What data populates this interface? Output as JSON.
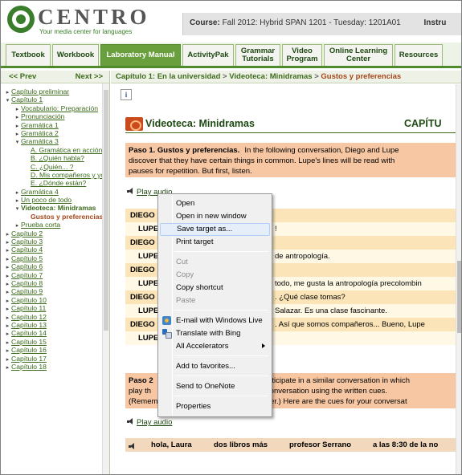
{
  "header": {
    "logo_text": "CENTRO",
    "logo_tagline": "Your media center for languages",
    "course_label": "Course:",
    "course_value": "Fall 2012: Hybrid SPAN 1201 - Tuesday: 1201A01",
    "course_tail": "Instru"
  },
  "tabs": [
    {
      "label": "Textbook",
      "active": false
    },
    {
      "label": "Workbook",
      "active": false
    },
    {
      "label": "Laboratory Manual",
      "active": true
    },
    {
      "label": "ActivityPak",
      "active": false
    },
    {
      "label": "Grammar Tutorials",
      "active": false
    },
    {
      "label": "Video Program",
      "active": false
    },
    {
      "label": "Online Learning Center",
      "active": false
    },
    {
      "label": "Resources",
      "active": false
    }
  ],
  "sidebar": {
    "prev": "<< Prev",
    "next": "Next >>",
    "items": [
      {
        "label": "Capítulo preliminar",
        "indent": 0,
        "toggle": "right"
      },
      {
        "label": "Capítulo 1",
        "indent": 0,
        "toggle": "down"
      },
      {
        "label": "Vocabulario: Preparación",
        "indent": 1,
        "toggle": "right"
      },
      {
        "label": "Pronunciación",
        "indent": 1,
        "toggle": "right"
      },
      {
        "label": "Gramática 1",
        "indent": 1,
        "toggle": "right"
      },
      {
        "label": "Gramática 2",
        "indent": 1,
        "toggle": "right"
      },
      {
        "label": "Gramática 3",
        "indent": 1,
        "toggle": "down"
      },
      {
        "label": "A. Gramática en acción:",
        "indent": 2,
        "toggle": ""
      },
      {
        "label": "B. ¿Quién habla?",
        "indent": 2,
        "toggle": ""
      },
      {
        "label": "C. ¿Quién... ?",
        "indent": 2,
        "toggle": ""
      },
      {
        "label": "D. Mis compañeros y yo",
        "indent": 2,
        "toggle": ""
      },
      {
        "label": "E. ¿Dónde están?",
        "indent": 2,
        "toggle": ""
      },
      {
        "label": "Gramática 4",
        "indent": 1,
        "toggle": "right"
      },
      {
        "label": "Un poco de todo",
        "indent": 1,
        "toggle": "right"
      },
      {
        "label": "Videoteca: Minidramas",
        "indent": 1,
        "toggle": "down",
        "state": "sel"
      },
      {
        "label": "Gustos y preferencias",
        "indent": 2,
        "toggle": "",
        "state": "cur"
      },
      {
        "label": "Prueba corta",
        "indent": 1,
        "toggle": "right"
      },
      {
        "label": "Capítulo 2",
        "indent": 0,
        "toggle": "right"
      },
      {
        "label": "Capítulo 3",
        "indent": 0,
        "toggle": "right"
      },
      {
        "label": "Capítulo 4",
        "indent": 0,
        "toggle": "right"
      },
      {
        "label": "Capítulo 5",
        "indent": 0,
        "toggle": "right"
      },
      {
        "label": "Capítulo 6",
        "indent": 0,
        "toggle": "right"
      },
      {
        "label": "Capítulo 7",
        "indent": 0,
        "toggle": "right"
      },
      {
        "label": "Capítulo 8",
        "indent": 0,
        "toggle": "right"
      },
      {
        "label": "Capítulo 9",
        "indent": 0,
        "toggle": "right"
      },
      {
        "label": "Capítulo 10",
        "indent": 0,
        "toggle": "right"
      },
      {
        "label": "Capítulo 11",
        "indent": 0,
        "toggle": "right"
      },
      {
        "label": "Capítulo 12",
        "indent": 0,
        "toggle": "right"
      },
      {
        "label": "Capítulo 13",
        "indent": 0,
        "toggle": "right"
      },
      {
        "label": "Capítulo 14",
        "indent": 0,
        "toggle": "right"
      },
      {
        "label": "Capítulo 15",
        "indent": 0,
        "toggle": "right"
      },
      {
        "label": "Capítulo 16",
        "indent": 0,
        "toggle": "right"
      },
      {
        "label": "Capítulo 17",
        "indent": 0,
        "toggle": "right"
      },
      {
        "label": "Capítulo 18",
        "indent": 0,
        "toggle": "right"
      }
    ]
  },
  "breadcrumb": {
    "part1": "Capítulo 1: En la universidad",
    "part2": "Videoteca: Minidramas",
    "part3": "Gustos y preferencias",
    "separator": ">"
  },
  "main": {
    "info_label": "i",
    "title": "Videoteca: Minidramas",
    "chapter_title": "CAPÍTU",
    "paso1": {
      "bold": "Paso 1. Gustos y preferencias.",
      "line1": "In the following conversation, Diego and Lupe",
      "line2": "discover that they have certain things in common. Lupe's lines will be read with",
      "line3": "pauses for repetition. But first, listen."
    },
    "play_audio": "Play audio",
    "dialogue": [
      {
        "who": "DIEGO",
        "text": "",
        "kind": "d"
      },
      {
        "who": "LUPE",
        "text": "!",
        "kind": "l"
      },
      {
        "who": "DIEGO",
        "text": "",
        "kind": "d"
      },
      {
        "who": "LUPE",
        "text": "de antropología.",
        "kind": "l"
      },
      {
        "who": "DIEGO",
        "text": "",
        "kind": "d"
      },
      {
        "who": "LUPE",
        "text": "todo, me gusta la antropología precolombin",
        "kind": "l"
      },
      {
        "who": "DIEGO",
        "text": ". ¿Qué clase tomas?",
        "kind": "d"
      },
      {
        "who": "LUPE",
        "text": "Salazar. Es una clase fascinante.",
        "kind": "l"
      },
      {
        "who": "DIEGO",
        "text": ". Así que somos compañeros... Bueno, Lupe",
        "kind": "d"
      },
      {
        "who": "LUPE",
        "text": "",
        "kind": "l"
      }
    ],
    "paso2": {
      "bold": "Paso 2",
      "line1": "participate in a similar conversation in which",
      "line2_left": "play th",
      "line2": "e conversation using the written cues.",
      "line3_left": "(Remem",
      "line3": "swer.) Here are the cues for your conversat"
    },
    "cues": [
      "hola, Laura",
      "dos libros más",
      "profesor Serrano",
      "a las 8:30 de la no"
    ]
  },
  "context_menu": {
    "items": [
      {
        "label": "Open",
        "state": "normal"
      },
      {
        "label": "Open in new window",
        "state": "normal"
      },
      {
        "label": "Save target as...",
        "state": "hover"
      },
      {
        "label": "Print target",
        "state": "normal"
      },
      {
        "label": "Cut",
        "state": "disabled"
      },
      {
        "label": "Copy",
        "state": "disabled"
      },
      {
        "label": "Copy shortcut",
        "state": "normal"
      },
      {
        "label": "Paste",
        "state": "disabled"
      },
      {
        "label": "E-mail with Windows Live",
        "state": "normal",
        "icon": "blog-icon"
      },
      {
        "label": "Translate with Bing",
        "state": "normal",
        "icon": "bing-translate-icon"
      },
      {
        "label": "All Accelerators",
        "state": "submenu"
      },
      {
        "label": "Add to favorites...",
        "state": "normal"
      },
      {
        "label": "Send to OneNote",
        "state": "normal"
      },
      {
        "label": "Properties",
        "state": "normal"
      }
    ]
  }
}
